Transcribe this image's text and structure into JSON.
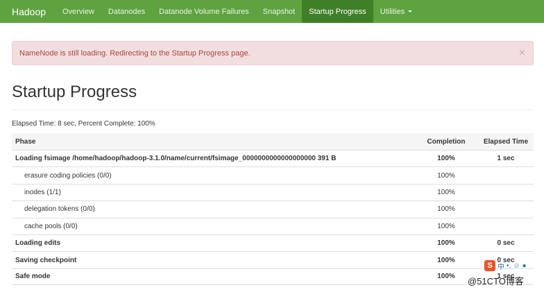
{
  "navbar": {
    "brand": "Hadoop",
    "items": [
      {
        "label": "Overview"
      },
      {
        "label": "Datanodes"
      },
      {
        "label": "Datanode Volume Failures"
      },
      {
        "label": "Snapshot"
      },
      {
        "label": "Startup Progress",
        "active": true
      },
      {
        "label": "Utilities",
        "dropdown": true
      }
    ]
  },
  "alert": {
    "message": "NameNode is still loading. Redirecting to the Startup Progress page.",
    "close": "×"
  },
  "page": {
    "title": "Startup Progress",
    "elapsed": "Elapsed Time: 8 sec, Percent Complete: 100%"
  },
  "table": {
    "headers": {
      "phase": "Phase",
      "completion": "Completion",
      "elapsed": "Elapsed Time"
    },
    "rows": [
      {
        "phase": "Loading fsimage /home/hadoop/hadoop-3.1.0/name/current/fsimage_0000000000000000000 391 B",
        "completion": "100%",
        "elapsed": "1 sec"
      },
      {
        "phase": "erasure coding policies (0/0)",
        "completion": "100%",
        "elapsed": ""
      },
      {
        "phase": "inodes (1/1)",
        "completion": "100%",
        "elapsed": ""
      },
      {
        "phase": "delegation tokens (0/0)",
        "completion": "100%",
        "elapsed": ""
      },
      {
        "phase": "cache pools (0/0)",
        "completion": "100%",
        "elapsed": ""
      },
      {
        "phase": "Loading edits",
        "completion": "100%",
        "elapsed": "0 sec"
      },
      {
        "phase": "Saving checkpoint",
        "completion": "100%",
        "elapsed": "0 sec"
      },
      {
        "phase": "Safe mode",
        "completion": "100%",
        "elapsed": "1 sec"
      }
    ]
  },
  "watermark": {
    "text": "@51CTO博客",
    "toolbar_logo": "S",
    "toolbar_text": "中"
  },
  "colors": {
    "navbar": "#5fa341",
    "navbar_active": "#3f7f27",
    "alert_bg": "#f2dede",
    "alert_text": "#a94442"
  }
}
